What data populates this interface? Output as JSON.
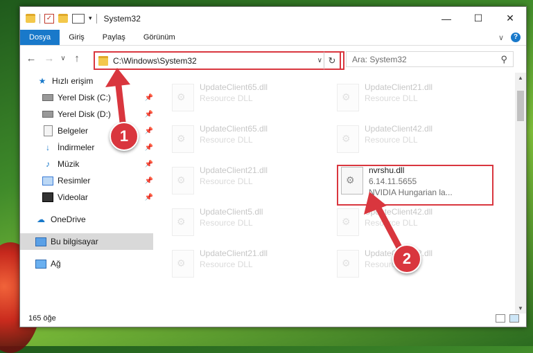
{
  "window": {
    "title": "System32",
    "controls": [
      "—",
      "☐",
      "✕"
    ]
  },
  "ribbon": {
    "tabs": [
      "Dosya",
      "Giriş",
      "Paylaş",
      "Görünüm"
    ],
    "expand": "∨",
    "help": "?"
  },
  "nav": {
    "back": "←",
    "forward": "→",
    "recent": "∨",
    "up": "↑"
  },
  "address": {
    "path": "C:\\Windows\\System32",
    "dropdown": "∨",
    "refresh": "↻"
  },
  "search": {
    "placeholder": "Ara: System32",
    "icon": "⚲"
  },
  "sidebar": {
    "items": [
      {
        "label": "Hızlı erişim",
        "icon": "star-icon"
      },
      {
        "label": "Yerel Disk (C:)",
        "icon": "disk-icon"
      },
      {
        "label": "Yerel Disk (D:)",
        "icon": "disk-icon"
      },
      {
        "label": "Belgeler",
        "icon": "document-icon"
      },
      {
        "label": "İndirmeler",
        "icon": "download-icon"
      },
      {
        "label": "Müzik",
        "icon": "music-icon"
      },
      {
        "label": "Resimler",
        "icon": "pictures-icon"
      },
      {
        "label": "Videolar",
        "icon": "videos-icon"
      },
      {
        "label": "OneDrive",
        "icon": "cloud-icon"
      },
      {
        "label": "Bu bilgisayar",
        "icon": "computer-icon"
      },
      {
        "label": "Ağ",
        "icon": "network-icon"
      }
    ]
  },
  "files": [
    {
      "name": "UpdateClient65.dll",
      "type": "Resource DLL"
    },
    {
      "name": "UpdateClient21.dll",
      "type": "Resource DLL"
    },
    {
      "name": "UpdateClient65.dll",
      "type": "Resource DLL"
    },
    {
      "name": "UpdateClient42.dll",
      "type": "Resource DLL"
    },
    {
      "name": "UpdateClient21.dll",
      "type": "Resource DLL"
    },
    {
      "name": "nvrshu.dll",
      "version": "6.14.11.5655",
      "type": "NVIDIA Hungarian la..."
    },
    {
      "name": "UpdateClient5.dll",
      "type": "Resource DLL"
    },
    {
      "name": "UpdateClient42.dll",
      "type": "Resource DLL"
    },
    {
      "name": "UpdateClient21.dll",
      "type": "Resource DLL"
    },
    {
      "name": "UpdateClient42.dll",
      "type": "Resource DLL"
    }
  ],
  "status": {
    "count": "165 öğe"
  },
  "annotations": {
    "step1": "1",
    "step2": "2",
    "accent": "#d9363e"
  }
}
